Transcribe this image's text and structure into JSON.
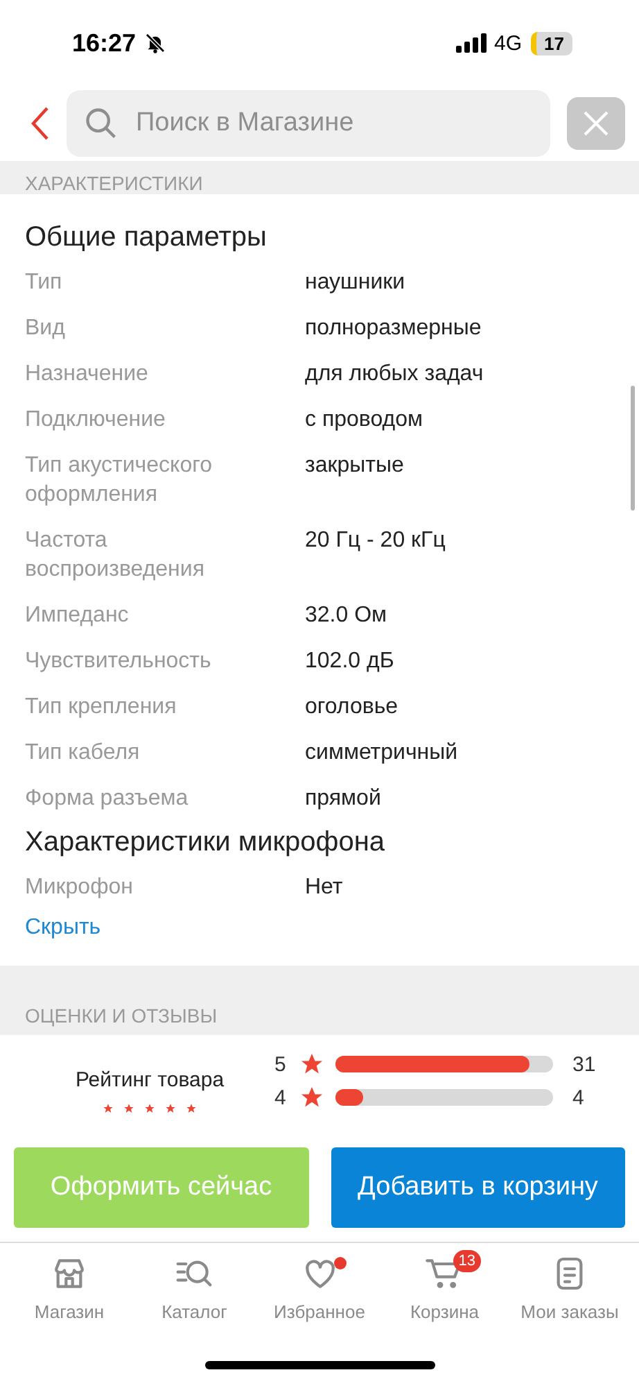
{
  "status_bar": {
    "time": "16:27",
    "network": "4G",
    "battery": "17"
  },
  "search": {
    "placeholder": "Поиск в Магазине"
  },
  "section_title": "ХАРАКТЕРИСТИКИ",
  "groups": [
    {
      "title": "Общие параметры",
      "rows": [
        {
          "label": "Тип",
          "value": "наушники"
        },
        {
          "label": "Вид",
          "value": "полноразмерные"
        },
        {
          "label": "Назначение",
          "value": "для любых задач"
        },
        {
          "label": "Подключение",
          "value": "с проводом"
        },
        {
          "label": "Тип акустического оформления",
          "value": "закрытые"
        },
        {
          "label": "Частота воспроизведения",
          "value": "20 Гц - 20 кГц"
        },
        {
          "label": "Импеданс",
          "value": "32.0 Ом"
        },
        {
          "label": "Чувствительность",
          "value": "102.0 дБ"
        },
        {
          "label": "Тип крепления",
          "value": "оголовье"
        },
        {
          "label": "Тип кабеля",
          "value": "симметричный"
        },
        {
          "label": "Форма разъема",
          "value": "прямой"
        }
      ]
    },
    {
      "title": "Характеристики микрофона",
      "rows": [
        {
          "label": "Микрофон",
          "value": "Нет"
        }
      ]
    }
  ],
  "hide_link": "Скрыть",
  "reviews": {
    "title": "ОЦЕНКИ И ОТЗЫВЫ",
    "rating_label": "Рейтинг товара",
    "stars": 5,
    "bars": [
      {
        "star": "5",
        "level": 0.89,
        "count": "31"
      },
      {
        "star": "4",
        "level": 0.13,
        "count": "4"
      }
    ]
  },
  "actions": [
    {
      "label": "Оформить сейчас",
      "kind": "secondary"
    },
    {
      "label": "Добавить в корзину",
      "kind": "primary"
    }
  ],
  "tabs": [
    {
      "label": "Магазин",
      "kind": "store",
      "dot": false
    },
    {
      "label": "Каталог",
      "kind": "catalog",
      "dot": false
    },
    {
      "label": "Избранное",
      "kind": "heart",
      "dot": true
    },
    {
      "label": "Корзина",
      "kind": "cart",
      "dot": false,
      "badge": "13"
    },
    {
      "label": "Мои заказы",
      "kind": "orders",
      "dot": false
    }
  ]
}
